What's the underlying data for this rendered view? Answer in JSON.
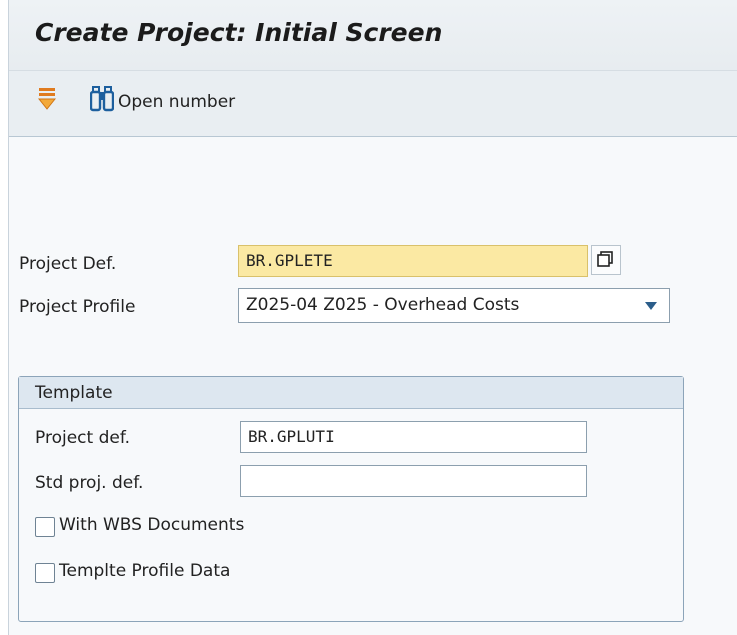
{
  "header": {
    "title": "Create Project: Initial Screen"
  },
  "toolbar": {
    "first_icon": "filter-icon",
    "open_number_icon": "binoculars-icon",
    "open_number_label": "Open number"
  },
  "form": {
    "project_def": {
      "label": "Project Def.",
      "value": "BR.GPLETE"
    },
    "project_profile": {
      "label": "Project Profile",
      "value": "Z025-04 Z025 -  Overhead Costs"
    }
  },
  "template": {
    "title": "Template",
    "project_def": {
      "label": "Project def.",
      "value": "BR.GPLUTI"
    },
    "std_proj_def": {
      "label": "Std proj. def.",
      "value": ""
    },
    "with_wbs_documents": {
      "label": "With WBS Documents",
      "checked": false
    },
    "template_profile_data": {
      "label": "Templte Profile Data",
      "checked": false
    }
  },
  "colors": {
    "required_field": "#fbe9a3",
    "accent": "#2b5d8a",
    "group_header": "#dde7f0"
  }
}
